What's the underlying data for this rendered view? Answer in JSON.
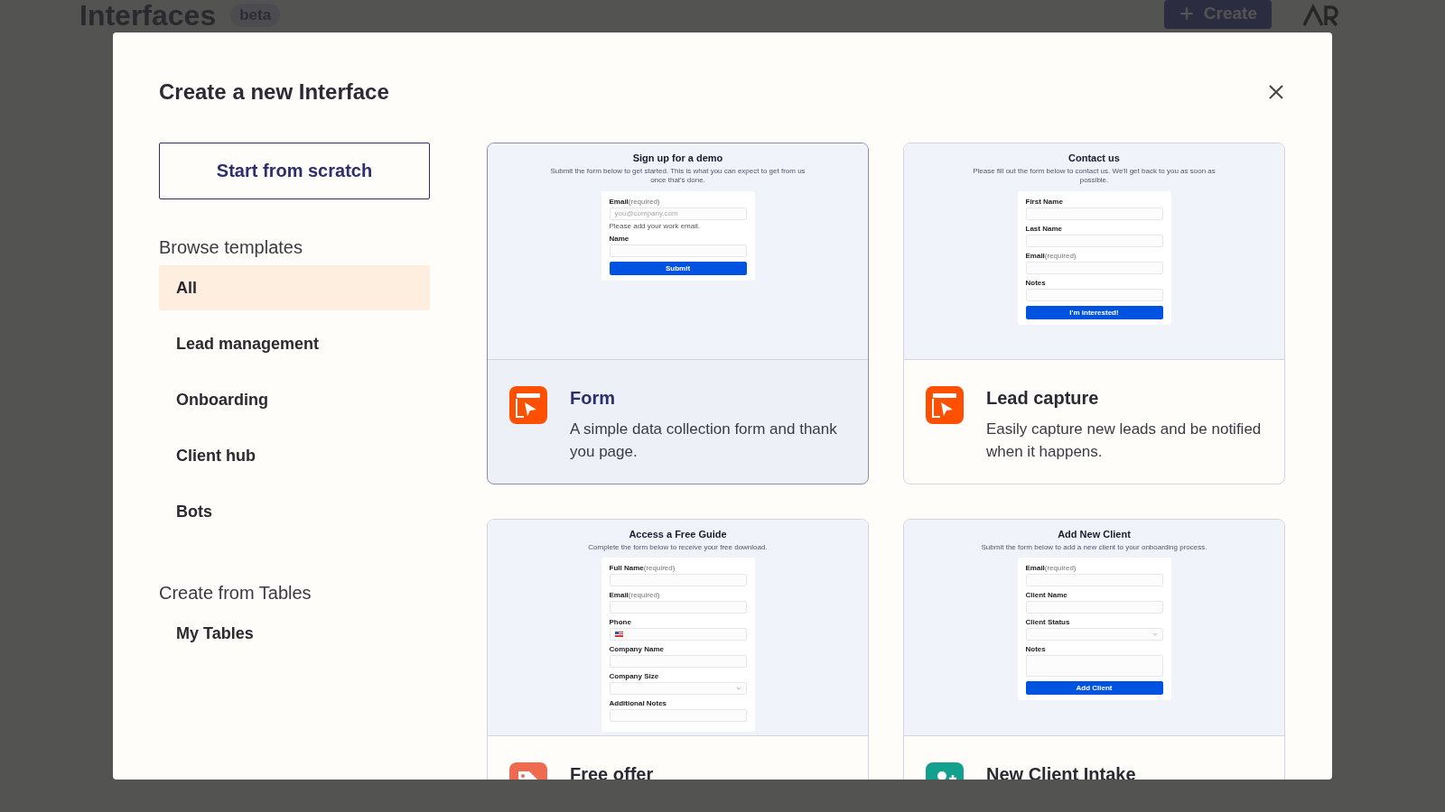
{
  "background": {
    "title": "Interfaces",
    "badge": "beta",
    "create_button": "Create"
  },
  "dialog": {
    "title": "Create a new Interface",
    "sidebar": {
      "start_button": "Start from scratch",
      "sections": [
        {
          "heading": "Browse templates",
          "items": [
            {
              "label": "All",
              "selected": true
            },
            {
              "label": "Lead management",
              "selected": false
            },
            {
              "label": "Onboarding",
              "selected": false
            },
            {
              "label": "Client hub",
              "selected": false
            },
            {
              "label": "Bots",
              "selected": false
            }
          ]
        },
        {
          "heading": "Create from Tables",
          "items": [
            {
              "label": "My Tables",
              "selected": false
            }
          ]
        }
      ]
    },
    "templates": [
      {
        "name": "Form",
        "description": "A simple data collection form and thank you page.",
        "kind": "window",
        "color": "#ff4f00",
        "highlighted": true,
        "preview": {
          "title": "Sign up for a demo",
          "subtitle": "Submit the form below to get started. This is what you can expect to get from us once that's done.",
          "fields": [
            {
              "label": "Email",
              "hint": "(required)",
              "kind": "input",
              "placeholder": "you@company.com",
              "help": "Please add your work email."
            },
            {
              "label": "Name",
              "kind": "input"
            }
          ],
          "button": "Submit"
        }
      },
      {
        "name": "Lead capture",
        "description": "Easily capture new leads and be notified when it happens.",
        "kind": "window",
        "color": "#ff4f00",
        "highlighted": false,
        "preview": {
          "title": "Contact us",
          "subtitle": "Please fill out the form below to contact us. We'll get back to you as soon as possible.",
          "fields": [
            {
              "label": "First Name",
              "kind": "input"
            },
            {
              "label": "Last Name",
              "kind": "input"
            },
            {
              "label": "Email",
              "hint": "(required)",
              "kind": "input"
            },
            {
              "label": "Notes",
              "kind": "input"
            }
          ],
          "button": "I'm interested!"
        }
      },
      {
        "name": "Free offer",
        "kind": "tag",
        "color": "#ef6b4f",
        "highlighted": false,
        "preview": {
          "title": "Access a Free Guide",
          "subtitle": "Complete the form below to receive your free download.",
          "fields": [
            {
              "label": "Full Name",
              "hint": "(required)",
              "kind": "input"
            },
            {
              "label": "Email",
              "hint": "(required)",
              "kind": "input"
            },
            {
              "label": "Phone",
              "kind": "phone"
            },
            {
              "label": "Company Name",
              "kind": "input"
            },
            {
              "label": "Company Size",
              "kind": "select"
            },
            {
              "label": "Additional Notes",
              "kind": "input"
            }
          ]
        }
      },
      {
        "name": "New Client Intake",
        "kind": "person",
        "color": "#13a08e",
        "highlighted": false,
        "preview": {
          "title": "Add New Client",
          "subtitle": "Submit the form below to add a new client to your onboarding process.",
          "fields": [
            {
              "label": "Email",
              "hint": "(required)",
              "kind": "input"
            },
            {
              "label": "Client Name",
              "kind": "input"
            },
            {
              "label": "Client Status",
              "kind": "select"
            },
            {
              "label": "Notes",
              "kind": "textarea"
            }
          ],
          "button": "Add Client"
        }
      }
    ]
  }
}
